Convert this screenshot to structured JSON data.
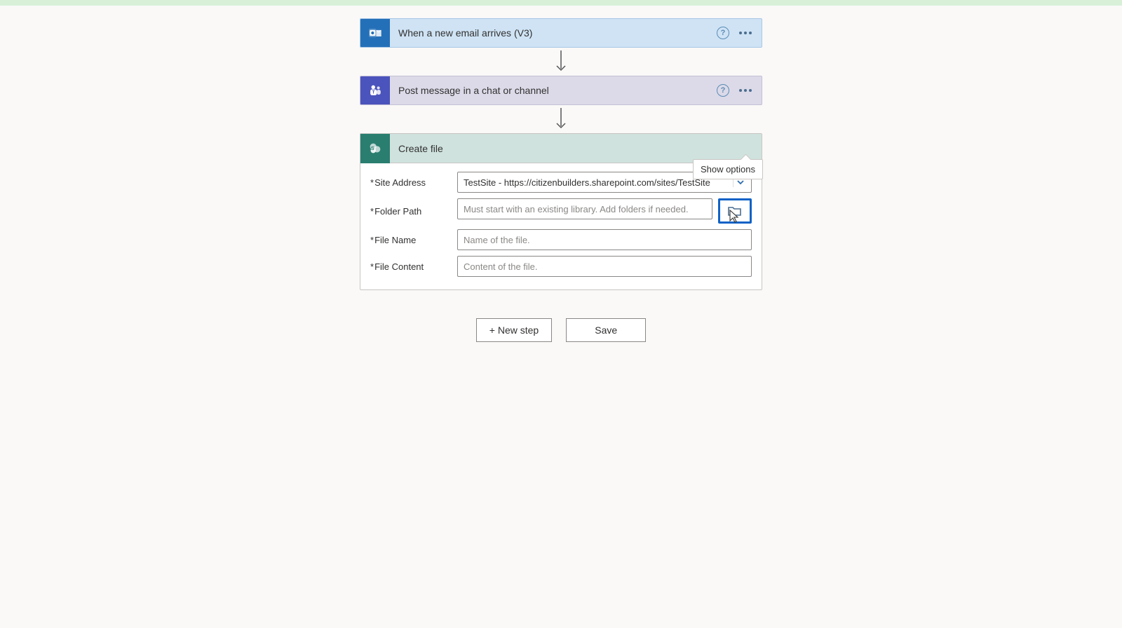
{
  "flow": {
    "steps": [
      {
        "icon": "outlook",
        "title": "When a new email arrives (V3)"
      },
      {
        "icon": "teams",
        "title": "Post message in a chat or channel"
      }
    ],
    "expanded": {
      "icon": "sharepoint",
      "title": "Create file",
      "show_options_label": "Show options",
      "fields": {
        "site_address": {
          "label": "Site Address",
          "value": "TestSite - https://citizenbuilders.sharepoint.com/sites/TestSite"
        },
        "folder_path": {
          "label": "Folder Path",
          "placeholder": "Must start with an existing library. Add folders if needed."
        },
        "file_name": {
          "label": "File Name",
          "placeholder": "Name of the file."
        },
        "file_content": {
          "label": "File Content",
          "placeholder": "Content of the file."
        }
      }
    }
  },
  "buttons": {
    "new_step": "+ New step",
    "save": "Save"
  },
  "glyphs": {
    "help": "?"
  }
}
